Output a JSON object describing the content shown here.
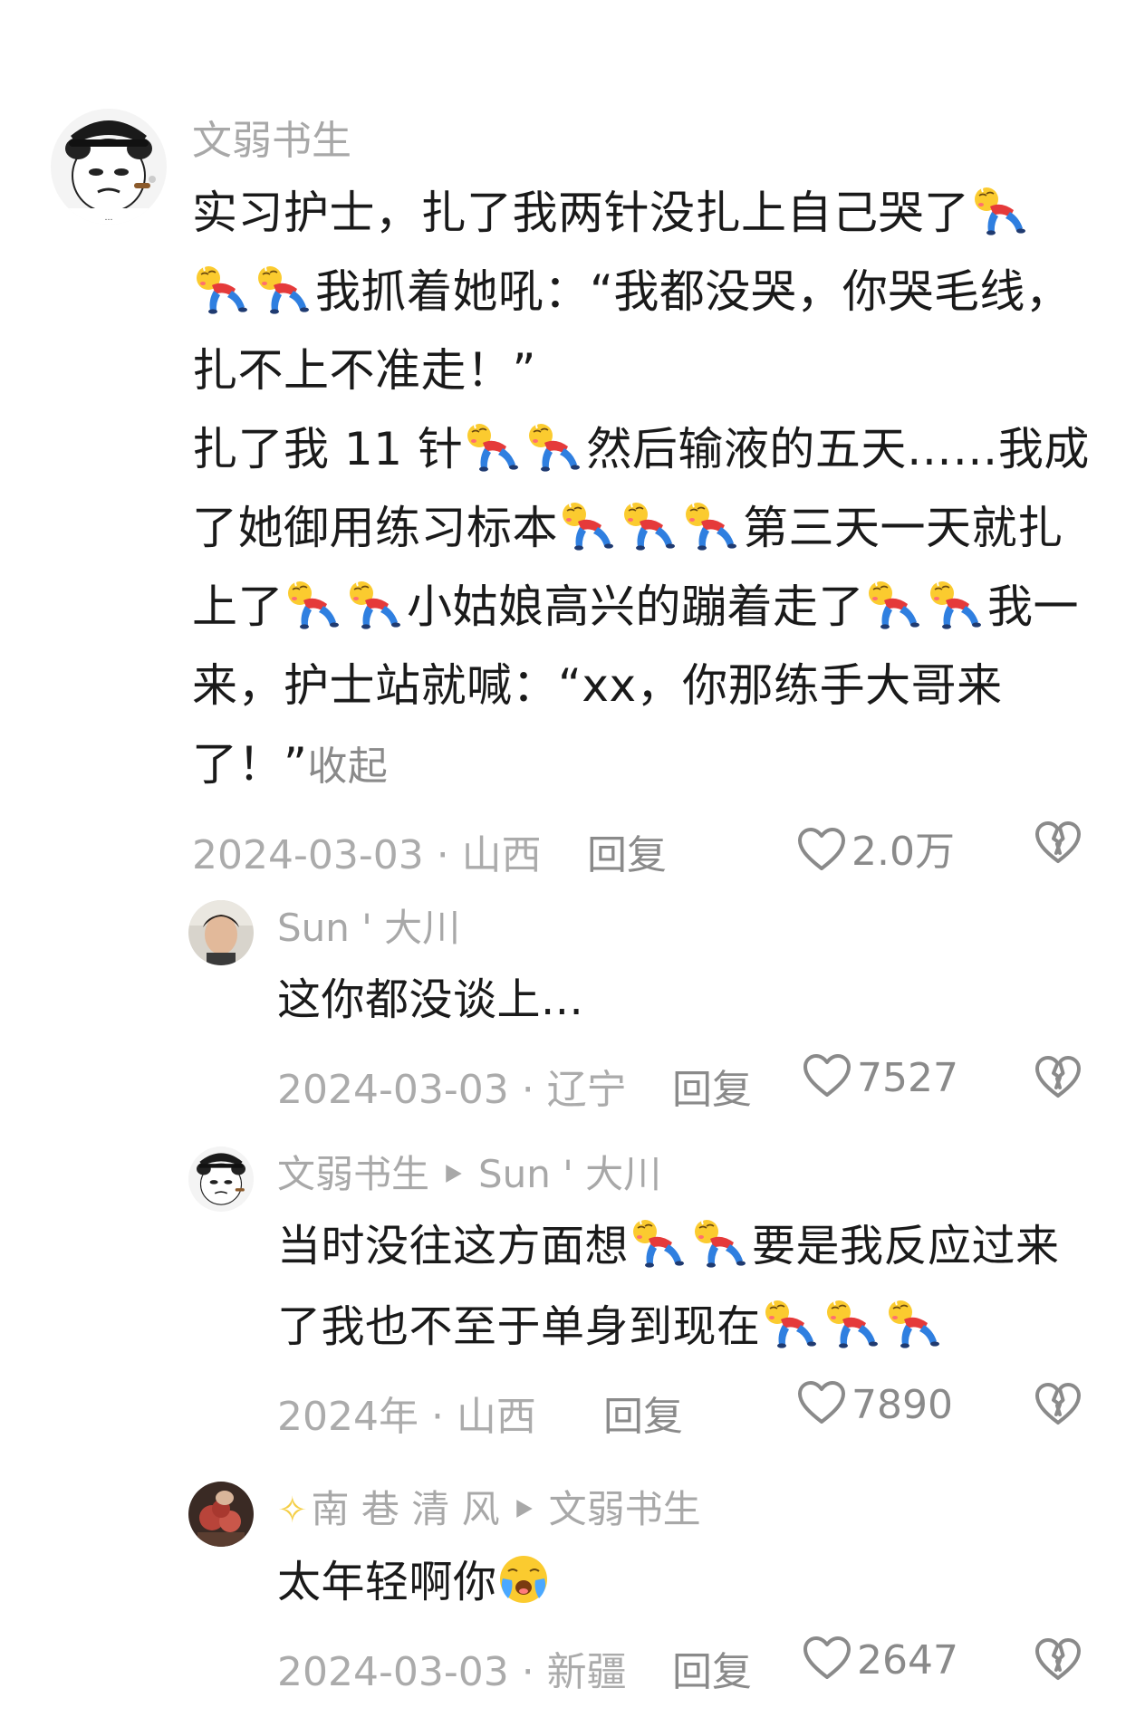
{
  "comments": [
    {
      "username": "文弱书生",
      "text_lines": [
        "实习护士，扎了我两针没扎上自己哭了",
        "我抓着她吼：“我都没哭，你哭毛线，扎不上不准走！”",
        "扎了我 11 针",
        "然后输液的五天……我成了她御用练习标本",
        "第三天一天就扎上了",
        "小姑娘高兴的蹦着走了",
        "我一来，护士站就喊：“xx，你那练手大哥来了！”"
      ],
      "collapse_label": "收起",
      "date_location": "2024-03-03 · 山西",
      "reply_label": "回复",
      "likes": "2.0万"
    },
    {
      "username": "Sun ' 大川",
      "text": "这你都没谈上...",
      "date_location": "2024-03-03 · 辽宁",
      "reply_label": "回复",
      "likes": "7527"
    },
    {
      "username": "文弱书生",
      "reply_to": "Sun ' 大川",
      "text_parts": [
        "当时没往这方面想",
        "要是我反应过来了我也不至于单身到现在"
      ],
      "date_location": "2024年 · 山西",
      "reply_label": "回复",
      "likes": "7890"
    },
    {
      "username": "南 巷 清 风",
      "reply_to": "文弱书生",
      "text": "太年轻啊你",
      "date_location": "2024-03-03 · 新疆",
      "reply_label": "回复",
      "likes": "2647"
    }
  ],
  "icons": {
    "like": "heart-outline-icon",
    "dislike": "broken-heart-icon",
    "emoji_cry": "lying-crying-emoji",
    "emoji_face": "crying-face-emoji",
    "reply_arrow": "play-triangle-icon"
  },
  "colors": {
    "text": "#1a1a1a",
    "muted": "#a8a8a8",
    "action": "#8a8a8a"
  }
}
